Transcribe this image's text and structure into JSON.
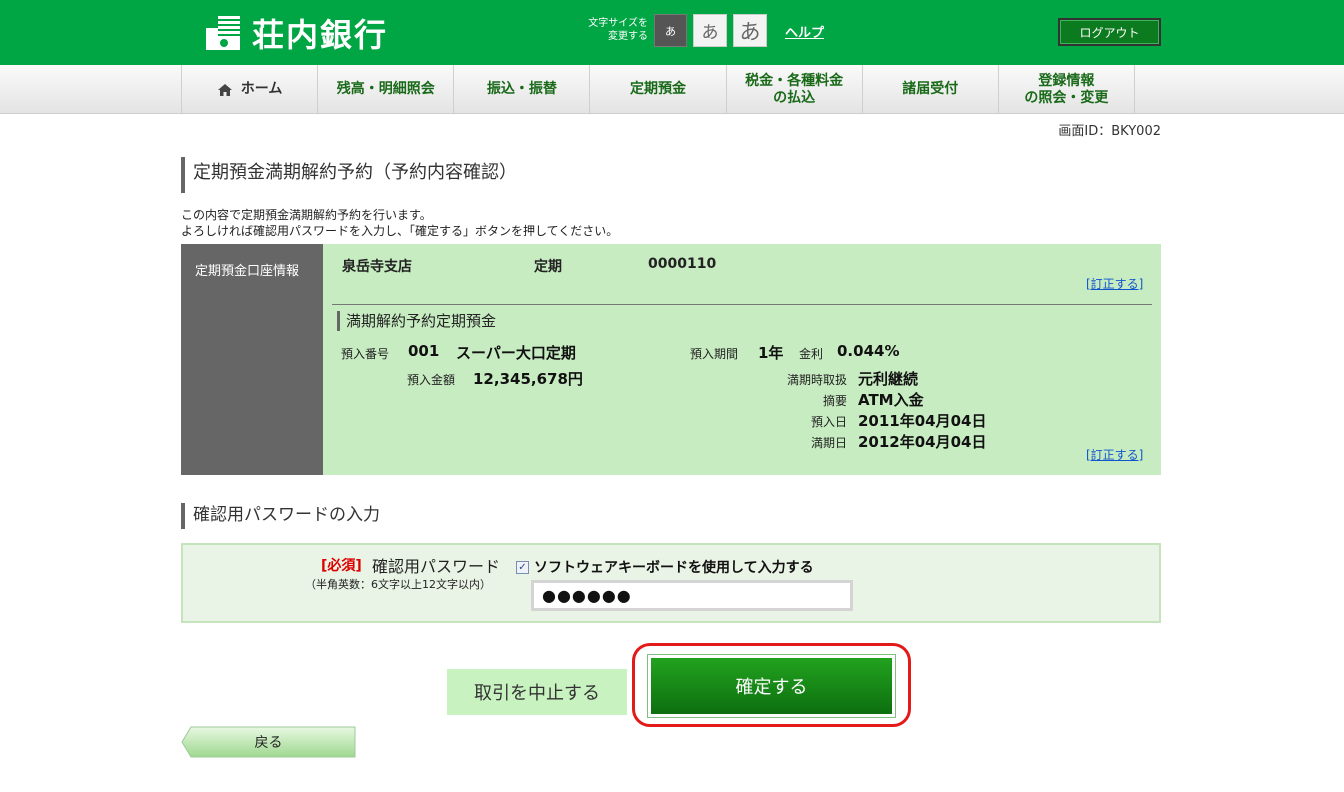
{
  "header": {
    "bank_name": "荘内銀行",
    "font_size_label": "文字サイズを\n変更する",
    "font_sizes": [
      "あ",
      "あ",
      "あ"
    ],
    "help_label": "ヘルプ",
    "logout_label": "ログアウト"
  },
  "nav": {
    "items": [
      {
        "label": "ホーム"
      },
      {
        "label": "残高・明細照会"
      },
      {
        "label": "振込・振替"
      },
      {
        "label": "定期預金"
      },
      {
        "label": "税金・各種料金\nの払込"
      },
      {
        "label": "諸届受付"
      },
      {
        "label": "登録情報\nの照会・変更"
      }
    ]
  },
  "screen_id": "画面ID：BKY002",
  "page_title": "定期預金満期解約予約（予約内容確認）",
  "intro": {
    "line1": "この内容で定期預金満期解約予約を行います。",
    "line2": "よろしければ確認用パスワードを入力し、「確定する」ボタンを押してください。"
  },
  "account": {
    "section_label": "定期預金口座情報",
    "branch": "泉岳寺支店",
    "type": "定期",
    "number": "0000110",
    "edit_label": "[訂正する]",
    "sub_title": "満期解約予約定期預金",
    "deposit_no_label": "預入番号",
    "deposit_no": "001",
    "product": "スーパー大口定期",
    "term_label": "預入期間",
    "term": "1年",
    "rate_label": "金利",
    "rate": "0.044%",
    "amount_label": "預入金額",
    "amount": "12,345,678円",
    "maturity_handling_label": "満期時取扱",
    "maturity_handling": "元利継続",
    "memo_label": "摘要",
    "memo": "ATM入金",
    "deposit_date_label": "預入日",
    "deposit_date": "2011年04月04日",
    "maturity_date_label": "満期日",
    "maturity_date": "2012年04月04日"
  },
  "password_section": {
    "title": "確認用パスワードの入力",
    "required": "[必須]",
    "label": "確認用パスワード",
    "hint": "（半角英数：6文字以上12文字以内）",
    "checkbox_checked": "✓",
    "checkbox_label": "ソフトウェアキーボードを使用して入力する",
    "value": "●●●●●●"
  },
  "buttons": {
    "cancel": "取引を中止する",
    "confirm": "確定する",
    "back": "戻る"
  },
  "colors": {
    "brand_green": "#00a544",
    "account_bg": "#c8ecc2",
    "highlight_red": "#e21a1a"
  }
}
